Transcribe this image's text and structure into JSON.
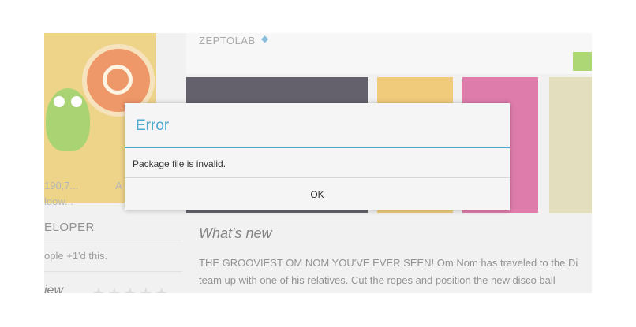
{
  "background": {
    "left_fragments": [
      "190,7...",
      "A",
      "ldow..."
    ],
    "developer_label": "ELOPER",
    "plus_ones": "ople +1'd this.",
    "review_label": "iew",
    "stars": "★★★★★",
    "developer_name": "ZEPTOLAB",
    "verified_icon": "verified-badge-icon",
    "whats_new_title": "What's new",
    "description_line1": "THE GROOVIEST OM NOM YOU'VE EVER SEEN! Om Nom has traveled to the Di",
    "description_line2": "team up with one of his relatives. Cut the ropes and position the new disco ball"
  },
  "dialog": {
    "title": "Error",
    "message": "Package file is invalid.",
    "ok_label": "OK"
  },
  "colors": {
    "accent": "#4aaad2",
    "install_green": "#8ec63f"
  }
}
